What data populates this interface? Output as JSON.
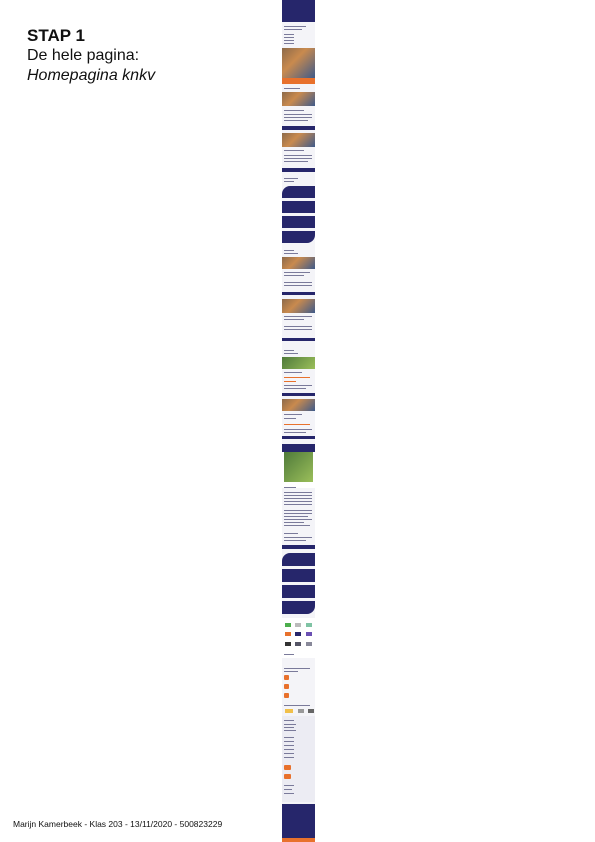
{
  "heading": {
    "step": "STAP 1",
    "line1": "De hele pagina:",
    "line2": "Homepagina knkv"
  },
  "footer": {
    "text": "Marijn Kamerbeek - Klas 203 - 13/11/2020 - 500823229"
  },
  "colors": {
    "navy": "#26266b",
    "orange": "#e8712c",
    "light": "#f4f4f8"
  }
}
